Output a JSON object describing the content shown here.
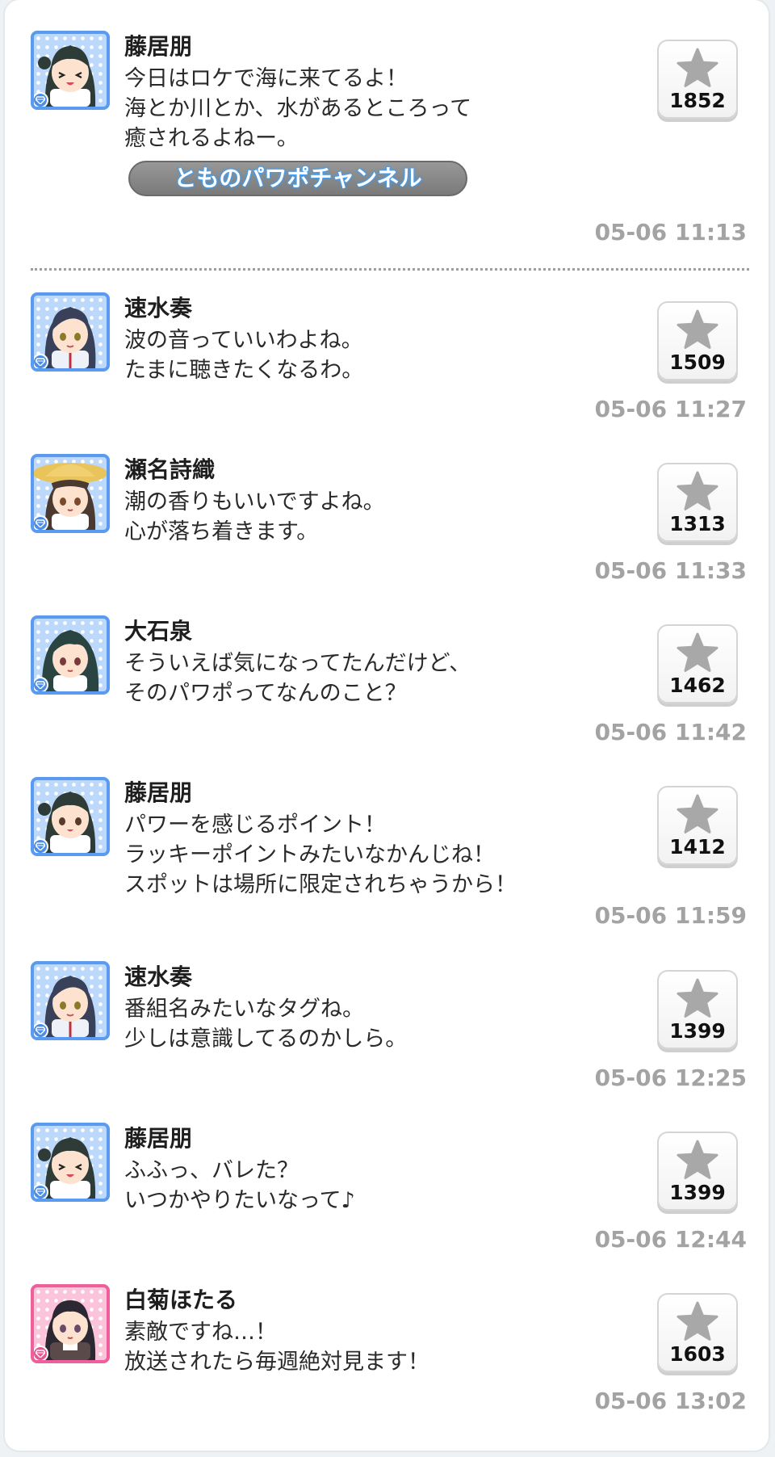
{
  "colors": {
    "avatar_blue": "#5a9bef",
    "avatar_pink": "#ee5f9c",
    "star_gray": "#a8a8a8",
    "timestamp_gray": "#a3a3a3",
    "tag_glow": "#3aa0ff"
  },
  "posts": [
    {
      "author": "藤居朋",
      "avatar_icon": "tomo-winking-avatar",
      "lines": [
        "今日はロケで海に来てるよ！",
        "海とか川とか、水があるところって",
        "癒されるよねー。"
      ],
      "tag": "とものパワポチャンネル",
      "likes": "1852",
      "time": "05-06 11:13"
    },
    {
      "author": "速水奏",
      "avatar_icon": "kanade-avatar",
      "lines": [
        "波の音っていいわよね。",
        "たまに聴きたくなるわ。"
      ],
      "likes": "1509",
      "time": "05-06 11:27"
    },
    {
      "author": "瀬名詩織",
      "avatar_icon": "shiori-straw-hat-avatar",
      "lines": [
        "潮の香りもいいですよね。",
        "心が落ち着きます。"
      ],
      "likes": "1313",
      "time": "05-06 11:33"
    },
    {
      "author": "大石泉",
      "avatar_icon": "izumi-avatar",
      "lines": [
        "そういえば気になってたんだけど、",
        "そのパワポってなんのこと？"
      ],
      "likes": "1462",
      "time": "05-06 11:42"
    },
    {
      "author": "藤居朋",
      "avatar_icon": "tomo-smiling-avatar",
      "lines": [
        "パワーを感じるポイント！",
        "ラッキーポイントみたいなかんじね！",
        "スポットは場所に限定されちゃうから！"
      ],
      "likes": "1412",
      "time": "05-06 11:59"
    },
    {
      "author": "速水奏",
      "avatar_icon": "kanade-avatar",
      "lines": [
        "番組名みたいなタグね。",
        "少しは意識してるのかしら。"
      ],
      "likes": "1399",
      "time": "05-06 12:25"
    },
    {
      "author": "藤居朋",
      "avatar_icon": "tomo-winking-avatar",
      "lines": [
        "ふふっ、バレた？",
        "いつかやりたいなって♪"
      ],
      "likes": "1399",
      "time": "05-06 12:44"
    },
    {
      "author": "白菊ほたる",
      "avatar_icon": "hotaru-avatar",
      "lines": [
        "素敵ですね…！",
        "放送されたら毎週絶対見ます！"
      ],
      "likes": "1603",
      "time": "05-06 13:02"
    }
  ]
}
